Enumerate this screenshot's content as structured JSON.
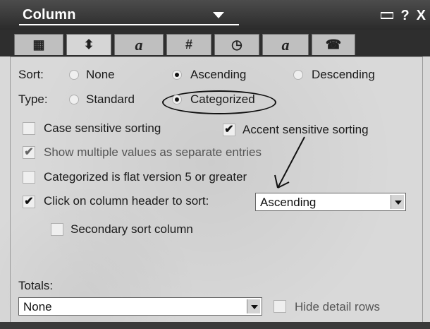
{
  "window": {
    "title": "Column",
    "controls": {
      "help": "?",
      "close": "X"
    }
  },
  "toolbar": {
    "tabs": [
      {
        "name": "tab-info-icon",
        "glyph": "▦"
      },
      {
        "name": "tab-sort-icon",
        "glyph": "⬍"
      },
      {
        "name": "tab-font-icon",
        "glyph": "a"
      },
      {
        "name": "tab-number-icon",
        "glyph": "#"
      },
      {
        "name": "tab-date-icon",
        "glyph": "◷"
      },
      {
        "name": "tab-title-font-icon",
        "glyph": "a"
      },
      {
        "name": "tab-advanced-icon",
        "glyph": "☎"
      }
    ]
  },
  "sort": {
    "label": "Sort:",
    "options": {
      "none": "None",
      "ascending": "Ascending",
      "descending": "Descending"
    },
    "selected": "Ascending"
  },
  "type": {
    "label": "Type:",
    "options": {
      "standard": "Standard",
      "categorized": "Categorized"
    },
    "selected": "Categorized"
  },
  "checkboxes": {
    "case_sensitive": {
      "label": "Case sensitive sorting",
      "checked": false
    },
    "accent_sensitive": {
      "label": "Accent sensitive sorting",
      "checked": true
    },
    "multiple_values": {
      "label": "Show multiple values as separate entries",
      "checked": true
    },
    "flat_version": {
      "label": "Categorized is flat version 5 or greater",
      "checked": false
    },
    "click_header": {
      "label": "Click on column header to sort:",
      "checked": true
    },
    "secondary_sort": {
      "label": "Secondary sort column",
      "checked": false
    }
  },
  "click_sort_select": {
    "value": "Ascending"
  },
  "totals": {
    "label": "Totals:",
    "select_value": "None",
    "hide_detail_label": "Hide detail rows",
    "hide_detail_checked": false
  }
}
